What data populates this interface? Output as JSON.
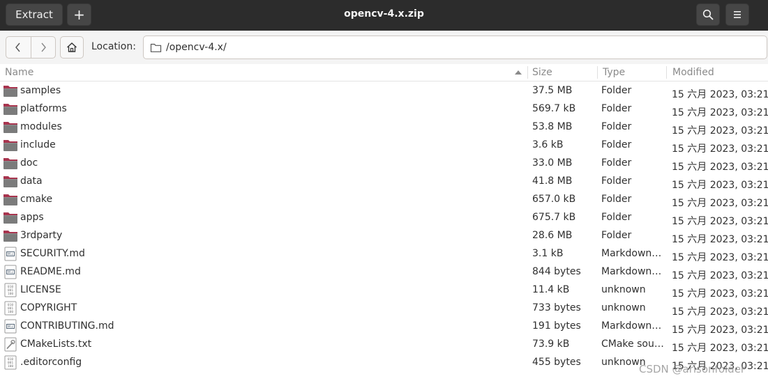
{
  "header": {
    "extract_label": "Extract",
    "add_label": "+",
    "title": "opencv-4.x.zip"
  },
  "toolbar": {
    "location_label": "Location:",
    "location_value": "/opencv-4.x/"
  },
  "columns": {
    "name": "Name",
    "size": "Size",
    "type": "Type",
    "modified": "Modified"
  },
  "files": [
    {
      "name": "samples",
      "size": "37.5 MB",
      "type": "Folder",
      "modified": "15 六月 2023, 03:21",
      "icon": "folder-icon"
    },
    {
      "name": "platforms",
      "size": "569.7 kB",
      "type": "Folder",
      "modified": "15 六月 2023, 03:21",
      "icon": "folder-icon"
    },
    {
      "name": "modules",
      "size": "53.8 MB",
      "type": "Folder",
      "modified": "15 六月 2023, 03:21",
      "icon": "folder-icon"
    },
    {
      "name": "include",
      "size": "3.6 kB",
      "type": "Folder",
      "modified": "15 六月 2023, 03:21",
      "icon": "folder-icon"
    },
    {
      "name": "doc",
      "size": "33.0 MB",
      "type": "Folder",
      "modified": "15 六月 2023, 03:21",
      "icon": "folder-icon"
    },
    {
      "name": "data",
      "size": "41.8 MB",
      "type": "Folder",
      "modified": "15 六月 2023, 03:21",
      "icon": "folder-icon"
    },
    {
      "name": "cmake",
      "size": "657.0 kB",
      "type": "Folder",
      "modified": "15 六月 2023, 03:21",
      "icon": "folder-icon"
    },
    {
      "name": "apps",
      "size": "675.7 kB",
      "type": "Folder",
      "modified": "15 六月 2023, 03:21",
      "icon": "folder-icon"
    },
    {
      "name": "3rdparty",
      "size": "28.6 MB",
      "type": "Folder",
      "modified": "15 六月 2023, 03:21",
      "icon": "folder-icon"
    },
    {
      "name": "SECURITY.md",
      "size": "3.1 kB",
      "type": "Markdown …",
      "modified": "15 六月 2023, 03:21",
      "icon": "markdown-file-icon"
    },
    {
      "name": "README.md",
      "size": "844 bytes",
      "type": "Markdown …",
      "modified": "15 六月 2023, 03:21",
      "icon": "markdown-file-icon"
    },
    {
      "name": "LICENSE",
      "size": "11.4 kB",
      "type": "unknown",
      "modified": "15 六月 2023, 03:21",
      "icon": "binary-file-icon"
    },
    {
      "name": "COPYRIGHT",
      "size": "733 bytes",
      "type": "unknown",
      "modified": "15 六月 2023, 03:21",
      "icon": "binary-file-icon"
    },
    {
      "name": "CONTRIBUTING.md",
      "size": "191 bytes",
      "type": "Markdown …",
      "modified": "15 六月 2023, 03:21",
      "icon": "markdown-file-icon"
    },
    {
      "name": "CMakeLists.txt",
      "size": "73.9 kB",
      "type": "CMake sou…",
      "modified": "15 六月 2023, 03:21",
      "icon": "cmake-file-icon"
    },
    {
      "name": ".editorconfig",
      "size": "455 bytes",
      "type": "unknown",
      "modified": "15 六月 2023, 03:21",
      "icon": "binary-file-icon"
    }
  ],
  "watermark": "CSDN @arisonfolder",
  "colors": {
    "headerbar": "#2c2c2c",
    "folder_tab": "#a8344e",
    "folder_body": "#7b7b7b"
  }
}
